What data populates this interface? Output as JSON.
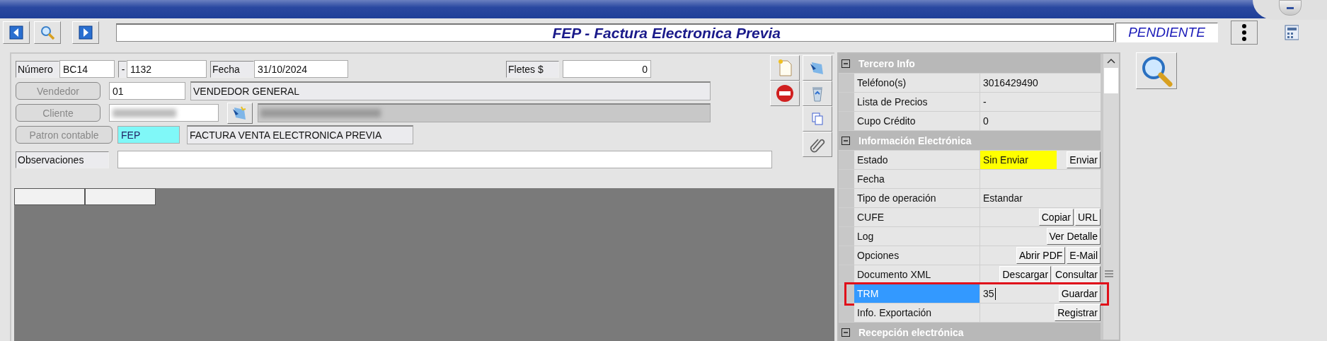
{
  "toolbar": {
    "title": "FEP - Factura Electronica Previa",
    "status": "PENDIENTE"
  },
  "form": {
    "numero_label": "Número",
    "serie": "BC14",
    "separator": "-",
    "numero": "1132",
    "fecha_label": "Fecha",
    "fecha": "31/10/2024",
    "fletes_label": "Fletes $",
    "fletes": "0",
    "vendedor_button": "Vendedor",
    "vendedor_code": "01",
    "vendedor_name": "VENDEDOR GENERAL",
    "cliente_button": "Cliente",
    "patron_button": "Patron contable",
    "patron_code": "FEP",
    "patron_name": "FACTURA VENTA ELECTRONICA PREVIA",
    "observaciones_label": "Observaciones"
  },
  "property_grid": {
    "sections": [
      {
        "title": "Tercero Info",
        "expanded": true,
        "rows": [
          {
            "label": "Teléfono(s)",
            "value": "3016429490",
            "selected": false
          },
          {
            "label": "Lista de Precios",
            "value": "-",
            "selected": false
          },
          {
            "label": "Cupo Crédito",
            "value": "0",
            "selected": false
          }
        ]
      },
      {
        "title": "Información Electrónica",
        "expanded": true,
        "rows": [
          {
            "label": "Estado",
            "value": "Sin Enviar",
            "highlighted": true,
            "buttons": [
              "Enviar"
            ],
            "selected": false
          },
          {
            "label": "Fecha",
            "selected": false
          },
          {
            "label": "Tipo de operación",
            "value": "Estandar",
            "selected": false
          },
          {
            "label": "CUFE",
            "buttons": [
              "Copiar",
              "URL"
            ],
            "selected": false
          },
          {
            "label": "Log",
            "buttons": [
              "Ver Detalle"
            ],
            "selected": false
          },
          {
            "label": "Opciones",
            "buttons": [
              "Abrir PDF",
              "E-Mail"
            ],
            "selected": false
          },
          {
            "label": "Documento XML",
            "buttons": [
              "Descargar",
              "Consultar"
            ],
            "selected": false
          },
          {
            "label": "TRM",
            "value": "35",
            "kind": "input",
            "buttons": [
              "Guardar"
            ],
            "selected": true,
            "outlined": true
          },
          {
            "label": "Info. Exportación",
            "buttons": [
              "Registrar"
            ],
            "selected": false
          }
        ]
      },
      {
        "title": "Recepción electrónica",
        "expanded": true
      }
    ]
  }
}
